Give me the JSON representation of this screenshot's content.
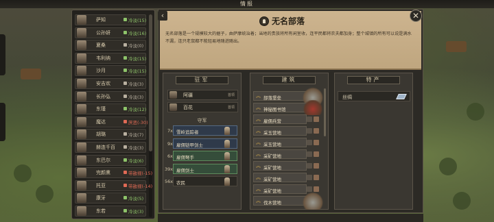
{
  "window": {
    "title": "情报"
  },
  "faction": {
    "name": "无名部落",
    "description": "无名部落是一个规模较大的据子，由萨摩统治着；当地的贵族将所有闲室收，连平民都将农夫都加身；整个城镇的所有可以说是满水不漏，连只老鼠都不能轻易地随进随出。"
  },
  "people": [
    {
      "name": "萨知",
      "mood": "冷淡(15)",
      "tone": "green"
    },
    {
      "name": "公孙妍",
      "mood": "冷淡(16)",
      "tone": "green"
    },
    {
      "name": "夏桑",
      "mood": "冷淡(0)",
      "tone": "gray"
    },
    {
      "name": "韦利纳",
      "mood": "冷淡(15)",
      "tone": "green"
    },
    {
      "name": "沙月",
      "mood": "冷淡(15)",
      "tone": "green"
    },
    {
      "name": "安吉欢",
      "mood": "冷淡(3)",
      "tone": "gray"
    },
    {
      "name": "长孙弘",
      "mood": "冷淡(3)",
      "tone": "gray"
    },
    {
      "name": "东瑾",
      "mood": "冷淡(12)",
      "tone": "green"
    },
    {
      "name": "魔达",
      "mood": "厌恶(-30)",
      "tone": "red"
    },
    {
      "name": "胡璐",
      "mood": "冷淡(7)",
      "tone": "gray"
    },
    {
      "name": "赫连千百",
      "mood": "冷淡(3)",
      "tone": "gray"
    },
    {
      "name": "东巴尔",
      "mood": "冷淡(6)",
      "tone": "green"
    },
    {
      "name": "完颜熏",
      "mood": "带敌视(-15)",
      "tone": "red"
    },
    {
      "name": "托亚",
      "mood": "带敌视(-14)",
      "tone": "red"
    },
    {
      "name": "康牙",
      "mood": "冷淡(5)",
      "tone": "green"
    },
    {
      "name": "东若",
      "mood": "冷淡(3)",
      "tone": "green"
    }
  ],
  "garrison": {
    "header": "驻军",
    "heroes": [
      {
        "name": "阿疆",
        "role": "首领"
      },
      {
        "name": "百花",
        "role": "首领"
      }
    ],
    "troops_label": "守军",
    "troops": [
      {
        "count": "7x",
        "name": "雪岭追踪者",
        "style": "blue"
      },
      {
        "count": "9x",
        "name": "雇佣铠甲剑士",
        "style": "blue"
      },
      {
        "count": "6x",
        "name": "雇佣弩手",
        "style": "green"
      },
      {
        "count": "39x",
        "name": "雇佣剑士",
        "style": "green"
      },
      {
        "count": "56x",
        "name": "农民",
        "style": "plain"
      }
    ]
  },
  "buildings": {
    "header": "建筑",
    "items": [
      "部落堡垒",
      "神秘图书馆",
      "雇佣兵营",
      "采玉营地",
      "采玉营地",
      "采矿营地",
      "采矿营地",
      "采矿营地",
      "采矿营地",
      "伐木营地"
    ]
  },
  "specialties": {
    "header": "特产",
    "items": [
      {
        "name": "丝绸",
        "icon": "silk-icon"
      }
    ]
  }
}
